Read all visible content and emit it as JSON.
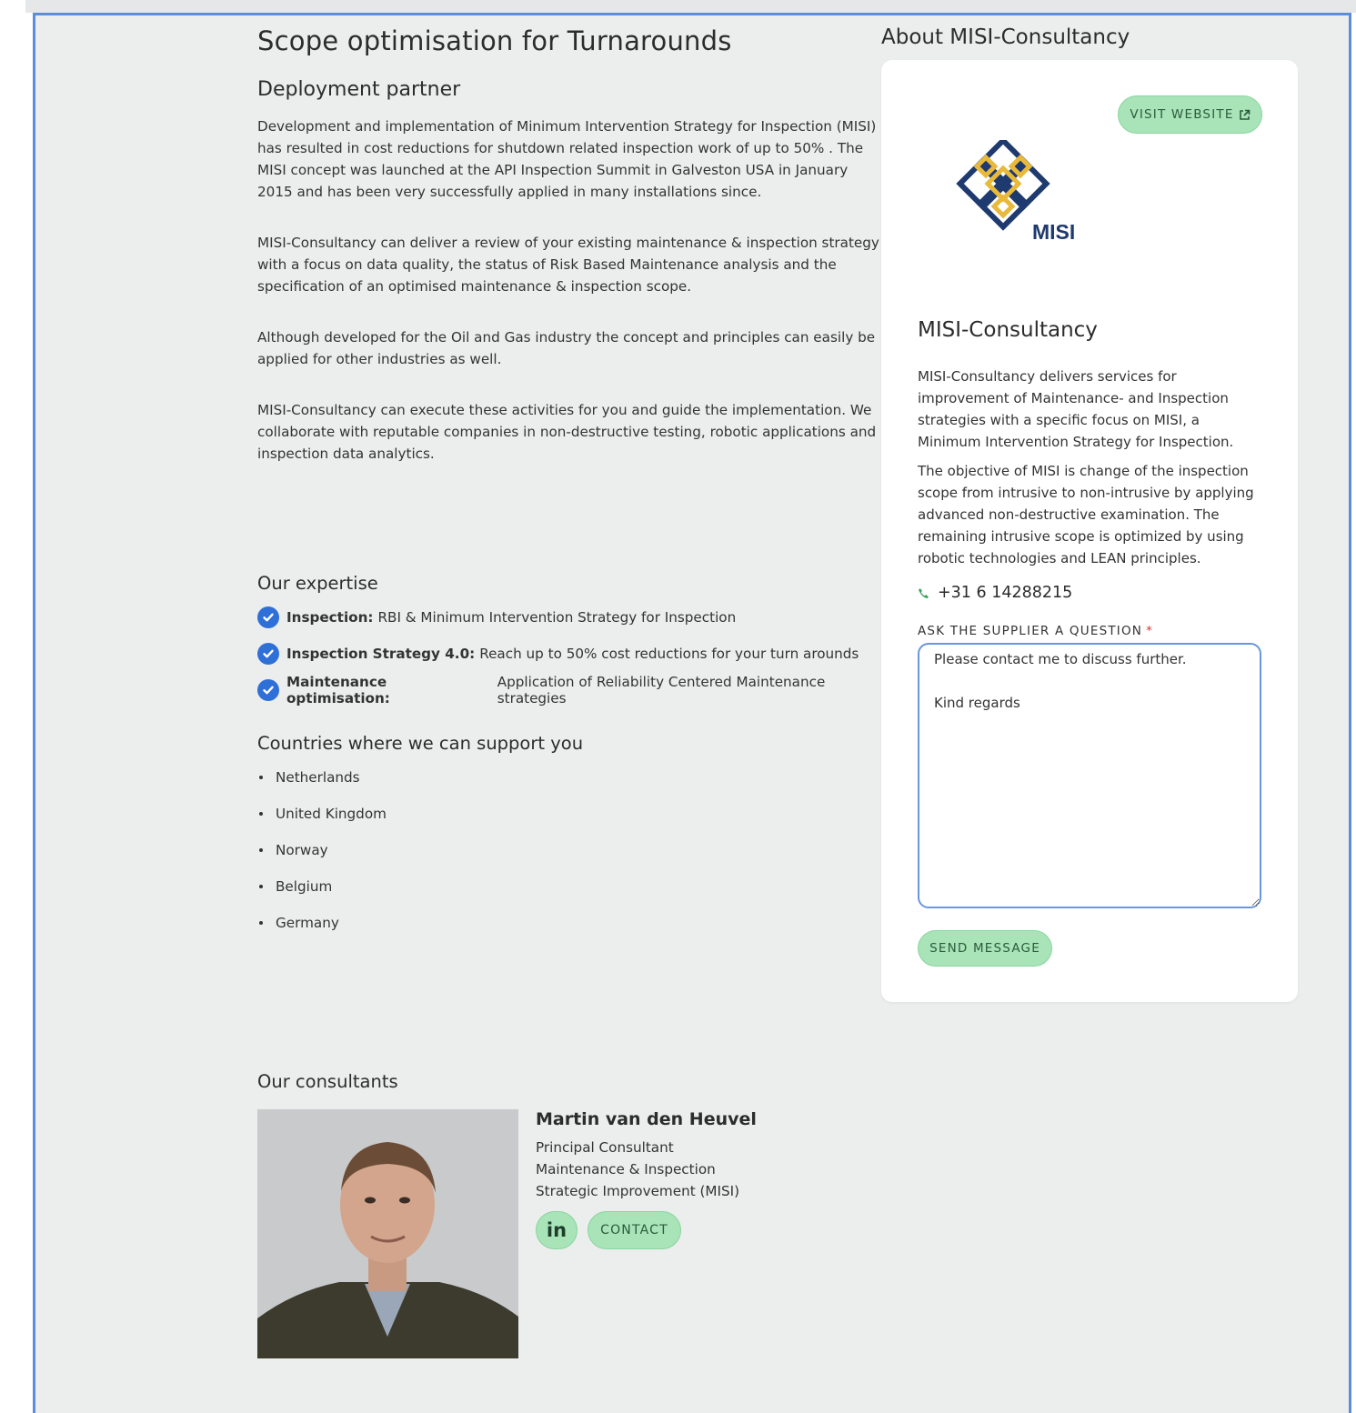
{
  "main": {
    "title": "Scope optimisation for Turnarounds",
    "subtitle": "Deployment partner",
    "paragraphs": [
      "Development and implementation of Minimum Intervention Strategy for Inspection (MISI) has resulted in cost reductions for shutdown related inspection work of up to 50% . The MISI concept was launched at the API Inspection Summit in Galveston USA in January 2015 and has been very successfully applied in many installations since.",
      "MISI-Consultancy can deliver a review of your existing maintenance & inspection strategy with a focus on data quality, the status of Risk Based Maintenance analysis and the specification of an optimised maintenance & inspection scope.",
      "Although developed for the Oil and Gas industry the concept and principles can easily be applied for other industries as well.",
      "MISI-Consultancy can execute these activities for you and guide the implementation. We collaborate with reputable companies in non-destructive testing, robotic applications and inspection data analytics."
    ]
  },
  "expertise": {
    "heading": "Our expertise",
    "items": [
      {
        "title": "Inspection:",
        "text": "RBI & Minimum Intervention Strategy for Inspection"
      },
      {
        "title": "Inspection Strategy 4.0:",
        "text": "Reach up to 50% cost reductions for your turn arounds"
      },
      {
        "title": "Maintenance optimisation:",
        "text": "Application of Reliability Centered Maintenance strategies"
      }
    ]
  },
  "countries": {
    "heading": "Countries where we can support you",
    "items": [
      "Netherlands",
      "United Kingdom",
      "Norway",
      "Belgium",
      "Germany"
    ]
  },
  "consultants": {
    "heading": "Our consultants",
    "person": {
      "name": "Martin van den Heuvel",
      "role_lines": [
        "Principal Consultant",
        "Maintenance & Inspection",
        "Strategic Improvement (MISI)"
      ],
      "linkedin_label": "in",
      "contact_label": "CONTACT"
    }
  },
  "about": {
    "heading": "About MISI-Consultancy",
    "visit_label": "VISIT WEBSITE",
    "logo_text": "MISI",
    "company_name": "MISI-Consultancy",
    "desc1": "MISI-Consultancy delivers services for improvement of Maintenance- and Inspection strategies with a specific focus on MISI, a Minimum Intervention Strategy for Inspection.",
    "desc2": "The objective of MISI is change of the inspection scope from intrusive to non-intrusive by applying advanced non-destructive examination. The remaining intrusive scope is optimized by using robotic technologies and LEAN principles.",
    "phone": "+31 6 14288215",
    "question_label": "ASK THE SUPPLIER A QUESTION",
    "required_mark": "*",
    "question_value": "Please contact me to discuss further.\n\nKind regards",
    "send_label": "SEND MESSAGE"
  },
  "colors": {
    "accent_green": "#a8e4b8",
    "check_blue": "#2f6fd8",
    "logo_navy": "#1f3a6e",
    "logo_gold": "#e8b93a"
  }
}
